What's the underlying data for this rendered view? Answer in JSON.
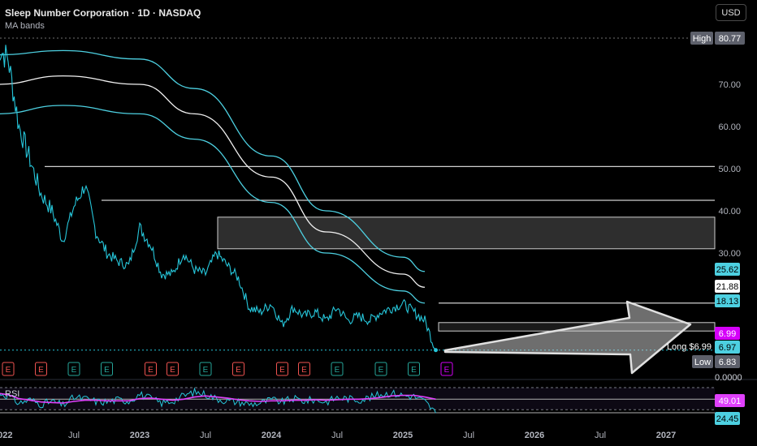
{
  "header": {
    "title": "Sleep Number Corporation · 1D · NASDAQ",
    "subtitle": "MA bands",
    "currency_button": "USD"
  },
  "colors": {
    "price": "#26c6da",
    "band": "#4dd0e1",
    "ma_mid": "#f2f2f2",
    "rsi": "#e040fb",
    "rsi_line": "#26c6da",
    "earnings_red": "#ef5350",
    "earnings_green": "#26a69a",
    "earnings_next": "#d500f9",
    "arrow": "#bdbdbd"
  },
  "chart_data": [
    {
      "type": "line",
      "title": "Sleep Number Corporation · 1D · NASDAQ",
      "price_axis": {
        "ticks": [
          "70.00",
          "60.00",
          "50.00",
          "40.00",
          "30.00"
        ],
        "ylim": [
          0,
          82
        ]
      },
      "time_axis": {
        "ticks": [
          "2022",
          "Jul",
          "2023",
          "Jul",
          "2024",
          "Jul",
          "2025",
          "Jul",
          "2026",
          "Jul",
          "2027"
        ]
      },
      "price_series": {
        "name": "Close",
        "x": [
          "2021-12",
          "2022-01",
          "2022-02",
          "2022-03",
          "2022-04",
          "2022-05",
          "2022-06",
          "2022-07",
          "2022-08",
          "2022-09",
          "2022-10",
          "2022-11",
          "2022-12",
          "2023-01",
          "2023-02",
          "2023-03",
          "2023-04",
          "2023-05",
          "2023-06",
          "2023-07",
          "2023-08",
          "2023-09",
          "2023-10",
          "2023-11",
          "2023-12",
          "2024-01",
          "2024-02",
          "2024-03",
          "2024-04",
          "2024-05",
          "2024-06",
          "2024-07",
          "2024-08",
          "2024-09",
          "2024-10",
          "2024-11",
          "2024-12",
          "2025-01",
          "2025-02",
          "2025-03",
          "2025-04"
        ],
        "values": [
          79,
          76,
          60,
          52,
          44,
          40,
          33,
          41,
          46,
          35,
          30,
          28,
          27,
          36,
          32,
          25,
          25,
          30,
          26,
          25,
          30,
          27,
          24,
          17,
          16,
          18,
          13,
          17,
          15,
          16,
          14,
          17,
          14,
          15,
          14,
          16,
          17,
          18,
          16,
          14,
          7
        ]
      },
      "ma_bands": {
        "x": [
          "2021-12",
          "2022-06",
          "2023-01",
          "2023-06",
          "2024-01",
          "2024-06",
          "2025-01",
          "2025-03"
        ],
        "upper": [
          77,
          78,
          76,
          69,
          53,
          40,
          29,
          25.62
        ],
        "middle": [
          70,
          72,
          70,
          63,
          48,
          35,
          25,
          21.88
        ],
        "lower": [
          63,
          65,
          63,
          57,
          42,
          30,
          21,
          18.13
        ]
      },
      "horizontal_levels": [
        50.5,
        42.5,
        18.13
      ],
      "zones": [
        {
          "from": 31,
          "to": 38.5
        },
        {
          "from": 11.5,
          "to": 13.5
        }
      ],
      "price_labels": [
        {
          "label": "High",
          "value": "80.77"
        },
        {
          "value": "25.62"
        },
        {
          "value": "21.88"
        },
        {
          "value": "18.13"
        },
        {
          "value": "6.99"
        },
        {
          "value": "6.97"
        },
        {
          "label": "Low",
          "value": "6.83"
        },
        {
          "value": "0.0000"
        }
      ],
      "position_label": "Long $6.99",
      "earnings_markers": [
        {
          "date": "2022-01",
          "kind": "red",
          "label": "E"
        },
        {
          "date": "2022-04",
          "kind": "red",
          "label": "E"
        },
        {
          "date": "2022-07",
          "kind": "green",
          "label": "E"
        },
        {
          "date": "2022-10",
          "kind": "green",
          "label": "E"
        },
        {
          "date": "2023-02",
          "kind": "red",
          "label": "E"
        },
        {
          "date": "2023-04",
          "kind": "red",
          "label": "E"
        },
        {
          "date": "2023-07",
          "kind": "green",
          "label": "E"
        },
        {
          "date": "2023-10",
          "kind": "red",
          "label": "E"
        },
        {
          "date": "2024-02",
          "kind": "red",
          "label": "E"
        },
        {
          "date": "2024-04",
          "kind": "red",
          "label": "E"
        },
        {
          "date": "2024-07",
          "kind": "green",
          "label": "E"
        },
        {
          "date": "2024-11",
          "kind": "green",
          "label": "E"
        },
        {
          "date": "2025-02",
          "kind": "green",
          "label": "E"
        },
        {
          "date": "2025-05",
          "kind": "next",
          "label": "E"
        }
      ]
    },
    {
      "type": "line",
      "title": "RSI",
      "labels": [
        "49.01",
        "24.45"
      ],
      "rsi": [
        62,
        55,
        42,
        48,
        40,
        45,
        38,
        52,
        50,
        45,
        44,
        48,
        46,
        58,
        50,
        42,
        46,
        55,
        62,
        58,
        50,
        46,
        44,
        40,
        42,
        48,
        44,
        50,
        46,
        48,
        44,
        52,
        50,
        48,
        52,
        58,
        60,
        56,
        54,
        45,
        24
      ],
      "rsi_ma": [
        60,
        57,
        50,
        47,
        44,
        43,
        42,
        45,
        47,
        47,
        46,
        46,
        46,
        50,
        51,
        49,
        47,
        49,
        53,
        55,
        53,
        51,
        48,
        46,
        45,
        46,
        46,
        47,
        47,
        48,
        47,
        48,
        49,
        49,
        50,
        52,
        55,
        56,
        56,
        53,
        49.01
      ]
    }
  ]
}
